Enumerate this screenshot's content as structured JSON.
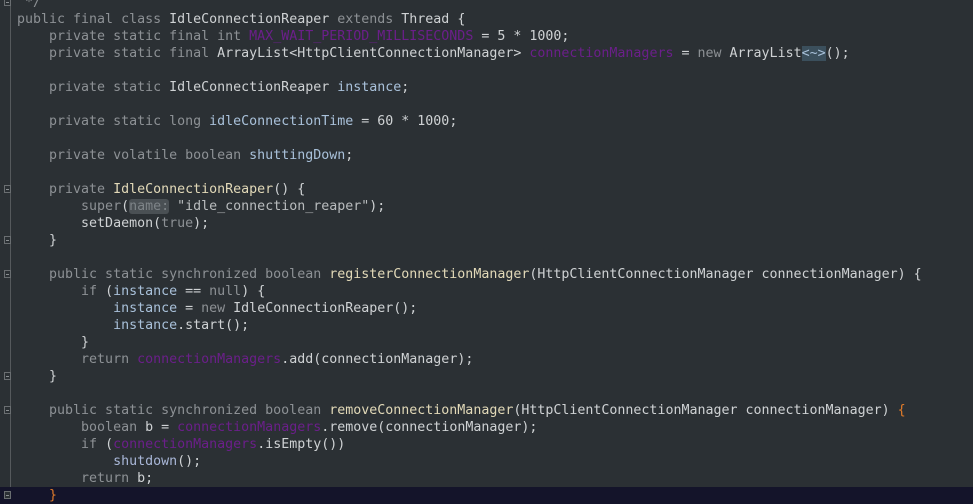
{
  "editor": {
    "language": "java",
    "current_line": 29,
    "colors": {
      "background": "#2b3034",
      "keyword": "#8d9195",
      "static_field": "#6b1f8a",
      "instance_field": "#a9c1da",
      "method_decl": "#e2d9b8",
      "matched_brace": "#e07b2a",
      "current_line": "#14142a"
    },
    "fold_lines": [
      0,
      11,
      14,
      16,
      22,
      24,
      29
    ],
    "lines": [
      [
        [
          "c",
          " */"
        ]
      ],
      [
        [
          "k",
          "public final class "
        ],
        [
          "t",
          "IdleConnectionReaper "
        ],
        [
          "k",
          "extends "
        ],
        [
          "t",
          "Thread {"
        ]
      ],
      [
        [
          "k",
          "    private static final int "
        ],
        [
          "f",
          "MAX_WAIT_PERIOD_MILLISECONDS"
        ],
        [
          "t",
          " = 5 * 1000;"
        ]
      ],
      [
        [
          "k",
          "    private static final "
        ],
        [
          "t",
          "ArrayList<HttpClientConnectionManager> "
        ],
        [
          "f",
          "connectionManagers"
        ],
        [
          "t",
          " = "
        ],
        [
          "k",
          "new "
        ],
        [
          "t",
          "ArrayList"
        ],
        [
          "d",
          "<~>"
        ],
        [
          "t",
          "();"
        ]
      ],
      [],
      [
        [
          "k",
          "    private static "
        ],
        [
          "t",
          "IdleConnectionReaper "
        ],
        [
          "i",
          "instance"
        ],
        [
          "t",
          ";"
        ]
      ],
      [],
      [
        [
          "k",
          "    private static long "
        ],
        [
          "i",
          "idleConnectionTime"
        ],
        [
          "t",
          " = 60 * 1000;"
        ]
      ],
      [],
      [
        [
          "k",
          "    private volatile boolean "
        ],
        [
          "i",
          "shuttingDown"
        ],
        [
          "t",
          ";"
        ]
      ],
      [],
      [
        [
          "k",
          "    private "
        ],
        [
          "m",
          "IdleConnectionReaper"
        ],
        [
          "t",
          "() {"
        ]
      ],
      [
        [
          "k",
          "        super"
        ],
        [
          "t",
          "("
        ],
        [
          "p",
          "name:"
        ],
        [
          "s",
          " \"idle_connection_reaper\""
        ],
        [
          "t",
          ");"
        ]
      ],
      [
        [
          "t",
          "        setDaemon("
        ],
        [
          "k",
          "true"
        ],
        [
          "t",
          ");"
        ]
      ],
      [
        [
          "t",
          "    }"
        ]
      ],
      [],
      [
        [
          "k",
          "    public static synchronized boolean "
        ],
        [
          "m",
          "registerConnectionManager"
        ],
        [
          "t",
          "(HttpClientConnectionManager connectionManager) {"
        ]
      ],
      [
        [
          "k",
          "        if "
        ],
        [
          "t",
          "("
        ],
        [
          "i",
          "instance"
        ],
        [
          "t",
          " == "
        ],
        [
          "k",
          "null"
        ],
        [
          "t",
          ") {"
        ]
      ],
      [
        [
          "i",
          "            instance"
        ],
        [
          "t",
          " = "
        ],
        [
          "k",
          "new "
        ],
        [
          "t",
          "IdleConnectionReaper();"
        ]
      ],
      [
        [
          "i",
          "            instance"
        ],
        [
          "t",
          ".start();"
        ]
      ],
      [
        [
          "t",
          "        }"
        ]
      ],
      [
        [
          "k",
          "        return "
        ],
        [
          "f",
          "connectionManagers"
        ],
        [
          "t",
          ".add(connectionManager);"
        ]
      ],
      [
        [
          "t",
          "    }"
        ]
      ],
      [],
      [
        [
          "k",
          "    public static synchronized boolean "
        ],
        [
          "m",
          "removeConnectionManager"
        ],
        [
          "t",
          "(HttpClientConnectionManager connectionManager) "
        ],
        [
          "b",
          "{"
        ]
      ],
      [
        [
          "k",
          "        boolean "
        ],
        [
          "t",
          "b = "
        ],
        [
          "f",
          "connectionManagers"
        ],
        [
          "t",
          ".remove(connectionManager);"
        ]
      ],
      [
        [
          "k",
          "        if "
        ],
        [
          "t",
          "("
        ],
        [
          "f",
          "connectionManagers"
        ],
        [
          "t",
          ".isEmpty())"
        ]
      ],
      [
        [
          "mc",
          "            shutdown"
        ],
        [
          "t",
          "();"
        ]
      ],
      [
        [
          "k",
          "        return "
        ],
        [
          "t",
          "b;"
        ]
      ],
      [
        [
          "b",
          "    }"
        ]
      ]
    ]
  }
}
